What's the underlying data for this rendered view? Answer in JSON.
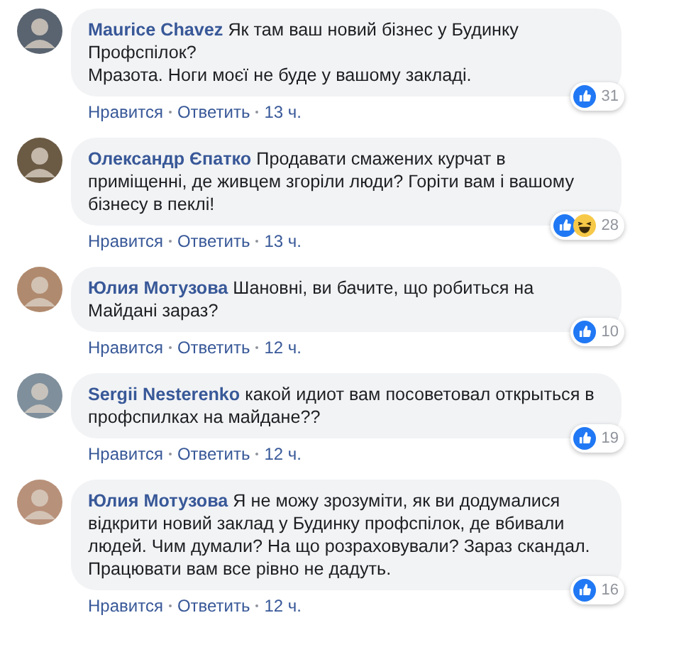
{
  "comments": [
    {
      "author": "Maurice Chavez",
      "text": "Як там ваш новий бізнес у Будинку Профспілок?\nМразота. Ноги моєї не буде у вашому закладі.",
      "reactions": [
        {
          "kind": "like"
        }
      ],
      "reaction_count": "31",
      "actions": [
        "Нравится",
        "Ответить"
      ],
      "time": "13 ч."
    },
    {
      "author": "Олександр Єпатко",
      "text": "Продавати смажених курчат в приміщенні, де живцем згоріли люди? Горіти вам і вашому бізнесу в пеклі!",
      "reactions": [
        {
          "kind": "like"
        },
        {
          "kind": "haha"
        }
      ],
      "reaction_count": "28",
      "actions": [
        "Нравится",
        "Ответить"
      ],
      "time": "13 ч."
    },
    {
      "author": "Юлия Мотузова",
      "text": "Шановні, ви бачите, що робиться на Майдані зараз?",
      "reactions": [
        {
          "kind": "like"
        }
      ],
      "reaction_count": "10",
      "actions": [
        "Нравится",
        "Ответить"
      ],
      "time": "12 ч."
    },
    {
      "author": "Sergii Nesterenko",
      "text": "какой идиот вам посоветовал открыться в профспилках на майдане??",
      "reactions": [
        {
          "kind": "like"
        }
      ],
      "reaction_count": "19",
      "actions": [
        "Нравится",
        "Ответить"
      ],
      "time": "12 ч."
    },
    {
      "author": "Юлия Мотузова",
      "text": "Я не можу зрозуміти, як ви додумалися відкрити новий заклад у Будинку профспілок, де вбивали людей. Чим думали? На що розраховували? Зараз скандал. Працювати вам все рівно не дадуть.",
      "reactions": [
        {
          "kind": "like"
        }
      ],
      "reaction_count": "16",
      "actions": [
        "Нравится",
        "Ответить"
      ],
      "time": "12 ч."
    }
  ]
}
